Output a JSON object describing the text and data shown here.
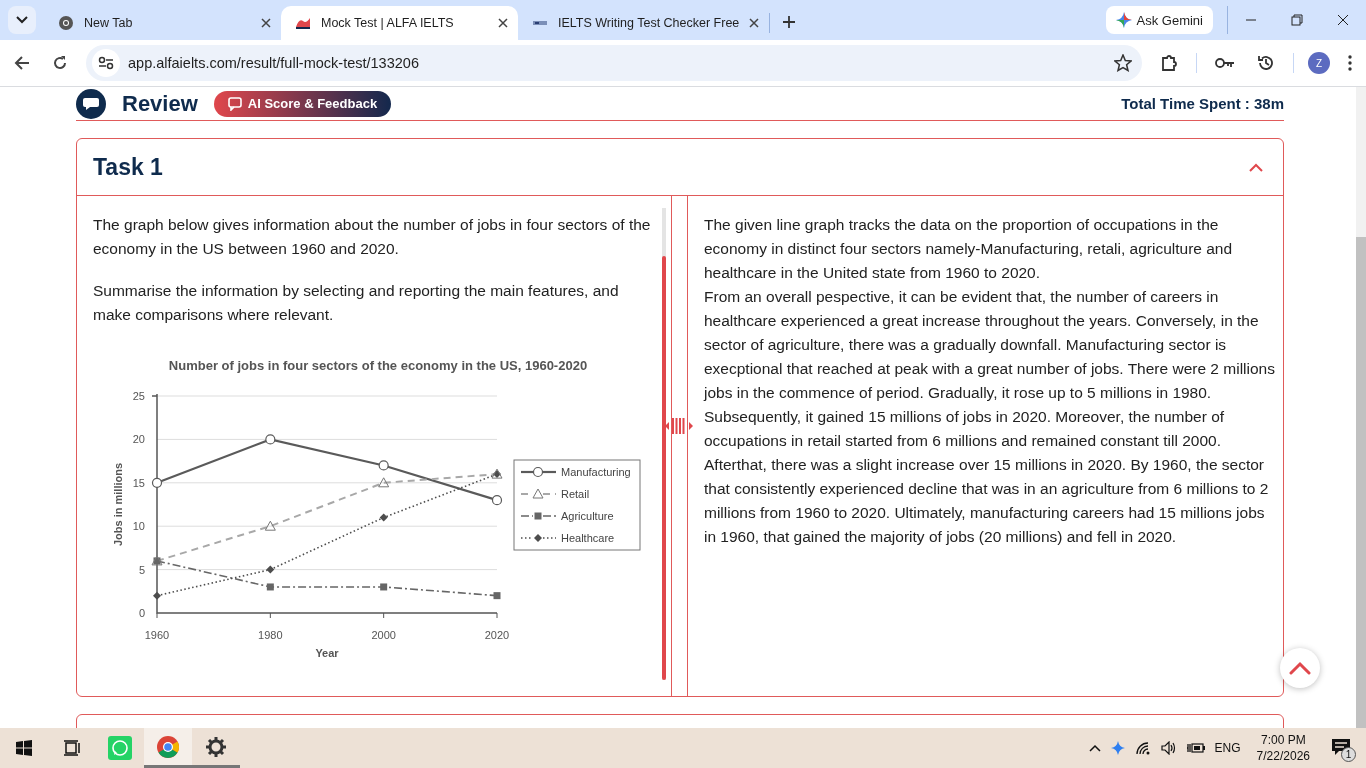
{
  "browser": {
    "tabs": [
      {
        "title": "New Tab",
        "selected": false
      },
      {
        "title": "Mock Test | ALFA IELTS",
        "selected": true
      },
      {
        "title": "IELTS Writing Test Checker Free",
        "selected": false
      }
    ],
    "ask_gemini": "Ask Gemini",
    "url": "app.alfaielts.com/result/full-mock-test/133206",
    "profile_initial": "Z"
  },
  "page": {
    "header": {
      "title": "Review",
      "ai_button": "AI Score & Feedback",
      "time_spent": "Total Time Spent : 38m"
    },
    "task": {
      "title": "Task 1",
      "expanded": true,
      "prompt": [
        "The graph below gives information about the number of jobs in four sectors of the economy in the US between 1960 and 2020.",
        "Summarise the information by selecting and reporting the main features, and make comparisons where relevant."
      ],
      "chart_data": {
        "type": "line",
        "title": "Number of jobs in four sectors of the economy in the US, 1960-2020",
        "xlabel": "Year",
        "ylabel": "Jobs in millions",
        "categories": [
          "1960",
          "1980",
          "2000",
          "2020"
        ],
        "ylim": [
          0,
          25
        ],
        "yticks": [
          0,
          5,
          10,
          15,
          20,
          25
        ],
        "grid": true,
        "legend": true,
        "series": [
          {
            "name": "Manufacturing",
            "color": "#5a5a5a",
            "line_style": "solid",
            "marker": "circle",
            "values": [
              15,
              20,
              17,
              13
            ]
          },
          {
            "name": "Retail",
            "color": "#a8a8a8",
            "line_style": "dashed",
            "marker": "triangle",
            "values": [
              6,
              10,
              15,
              16
            ]
          },
          {
            "name": "Agriculture",
            "color": "#666666",
            "line_style": "dashdot",
            "marker": "square",
            "values": [
              6,
              3,
              3,
              2
            ]
          },
          {
            "name": "Healthcare",
            "color": "#4d4d4d",
            "line_style": "dotted",
            "marker": "diamond",
            "values": [
              2,
              5,
              11,
              16
            ]
          }
        ]
      },
      "response": [
        "The given line graph tracks the data on the proportion of occupations in the economy in distinct four sectors namely-Manufacturing, retali, agriculture and healthcare in the United state from 1960 to 2020.",
        "From an overall pespective, it can be evident that, the number of careers in healthcare experienced a great increase throughout the years. Conversely, in the sector of agriculture, there was a gradually downfall. Manufacturing sector is execptional that reached at peak with a great number of jobs. There were 2 millions jobs in the commence of period. Gradually, it rose up to 5 millions in 1980. Subsequently, it gained 15 millions of jobs in 2020. Moreover, the number of occupations in retail started from 6 millions and remained constant till 2000.",
        "Afterthat, there was a slight increase over 15 millions in 2020. By 1960, the sector that consistently experienced decline that was in an agriculture from 6 millions to 2 millions from 1960 to 2020. Ultimately, manufacturing careers had 15 millions jobs in 1960, that gained the majority of jobs (20 millions) and fell in 2020."
      ]
    }
  },
  "taskbar": {
    "language": "ENG",
    "time": "7:00 PM",
    "date": "7/22/2026",
    "notifications": "1"
  }
}
